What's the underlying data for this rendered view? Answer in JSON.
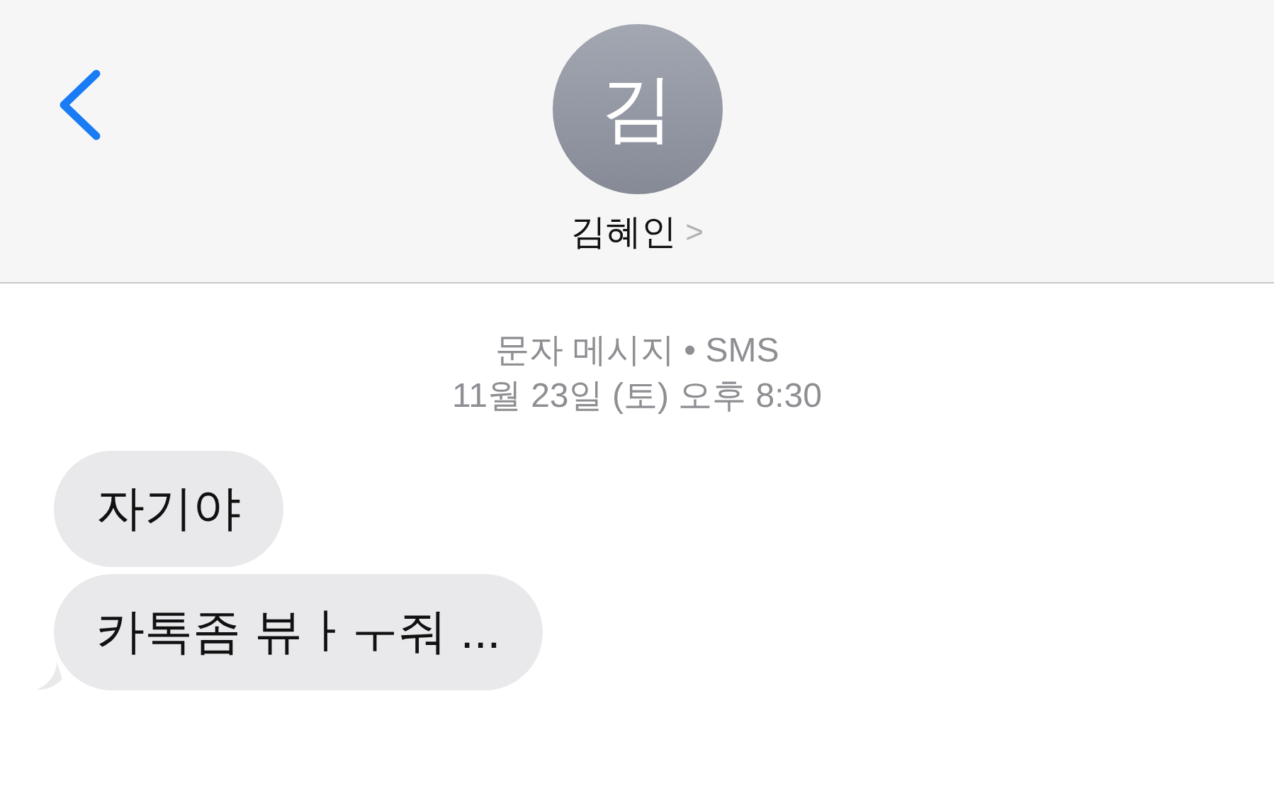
{
  "header": {
    "avatar_initial": "김",
    "contact_name": "김혜인",
    "name_chevron": ">"
  },
  "conversation": {
    "service": "문자 메시지 • SMS",
    "timestamp": "11월 23일 (토) 오후 8:30",
    "messages": [
      {
        "text": "자기야",
        "tail": false
      },
      {
        "text": "카톡좀 뷰ㅏㅜ줘 ...",
        "tail": true
      }
    ]
  }
}
